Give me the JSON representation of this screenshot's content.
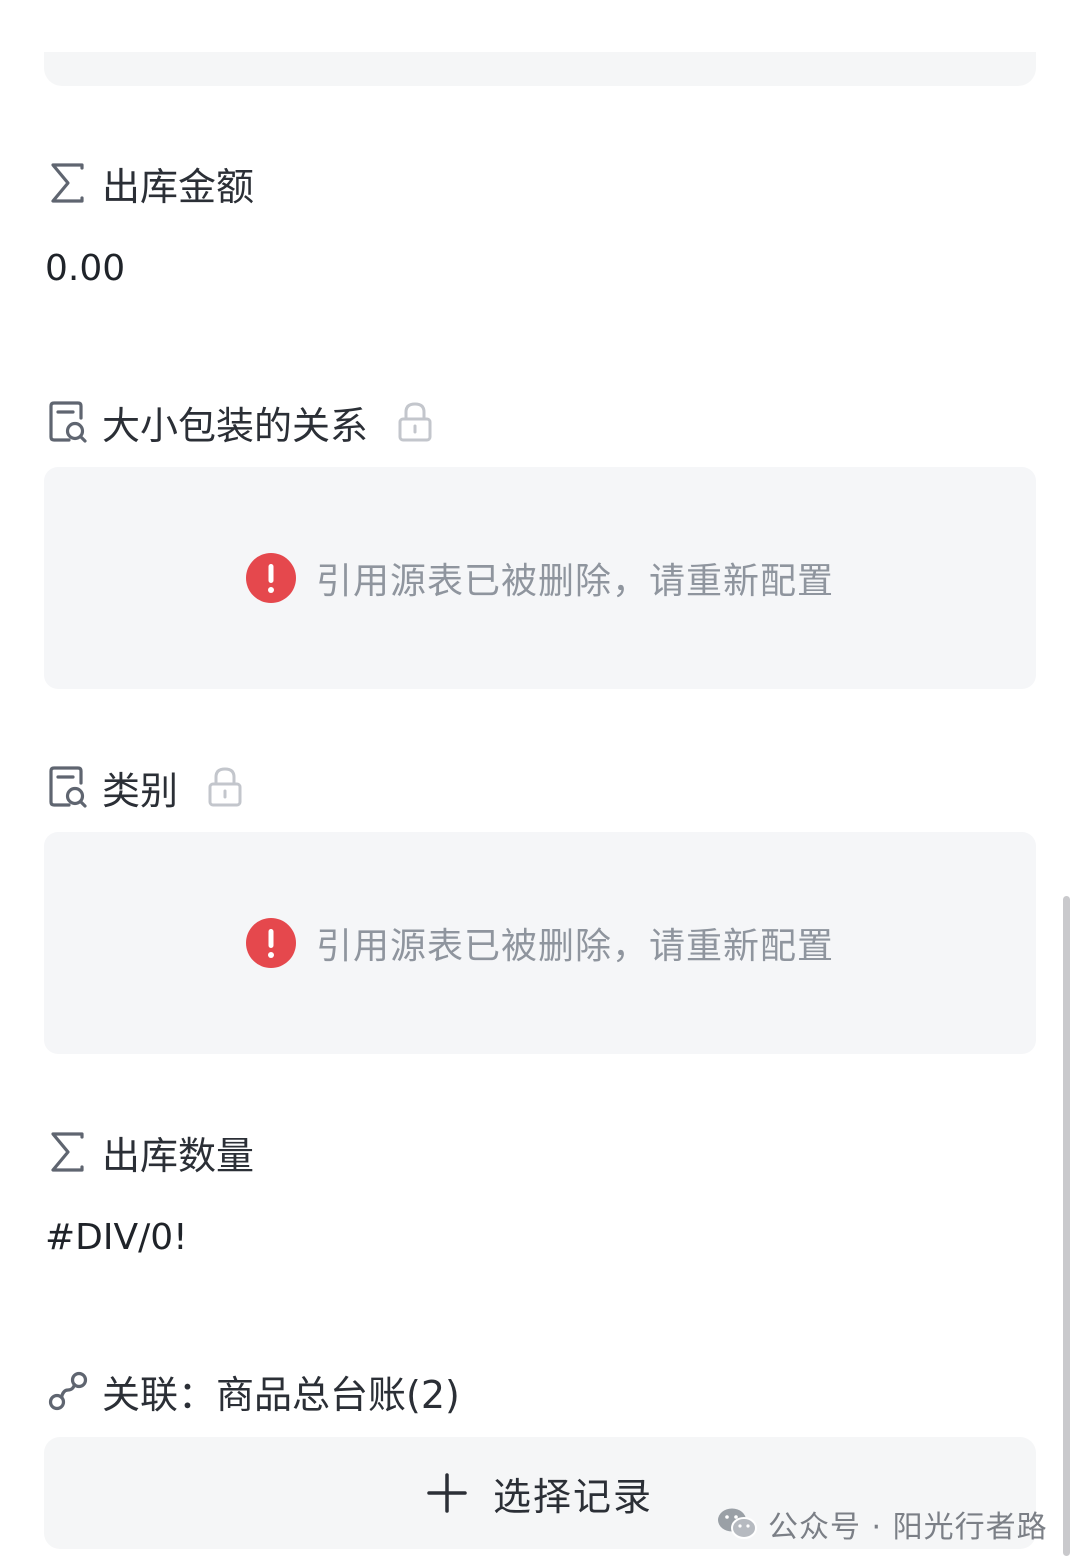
{
  "top_partial": {
    "left_text": "",
    "right_text": ""
  },
  "fields": [
    {
      "label": "出库金额",
      "icon": "sigma-icon",
      "value": "0.00"
    },
    {
      "label": "大小包装的关系",
      "icon": "lookup-icon",
      "locked": true,
      "error": "引用源表已被删除，请重新配置"
    },
    {
      "label": "类别",
      "icon": "lookup-icon",
      "locked": true,
      "error": "引用源表已被删除，请重新配置"
    },
    {
      "label": "出库数量",
      "icon": "sigma-icon",
      "value": "#DIV/0!"
    },
    {
      "label": "关联：商品总台账(2)",
      "icon": "link-icon"
    }
  ],
  "select_button": {
    "label": "选择记录"
  },
  "watermark": {
    "text": "公众号 · 阳光行者路"
  },
  "colors": {
    "error_red": "#e5484d",
    "accent_blue": "#2f6fed",
    "muted_text": "#8f959e"
  }
}
